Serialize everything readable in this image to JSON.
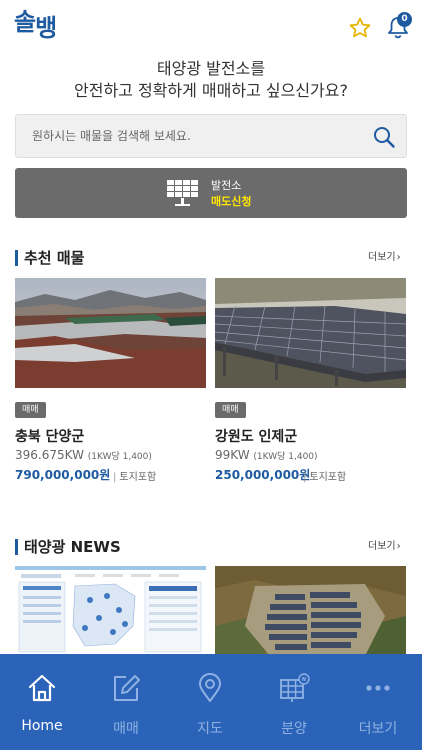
{
  "header": {
    "logo_line1": "솔",
    "logo_line2": "뱅",
    "notification_count": "0"
  },
  "hero": {
    "line1": "태양광 발전소를",
    "line2": "안전하고 정확하게 매매하고 싶으신가요?"
  },
  "search": {
    "placeholder": "원하시는 매물을 검색해 보세요."
  },
  "sell_button": {
    "line1": "발전소",
    "line2": "매도신청"
  },
  "recommended": {
    "title": "추천 매물",
    "more": "더보기",
    "items": [
      {
        "badge": "매매",
        "location": "충북 단양군",
        "capacity": "396.675KW",
        "unit_price": "(1KW당 1,400)",
        "price": "790,000,000원",
        "land": "토지포함"
      },
      {
        "badge": "매매",
        "location": "강원도 인제군",
        "capacity": "99KW",
        "unit_price": "(1KW당 1,400)",
        "price": "250,000,000원",
        "land": "토지포함"
      }
    ]
  },
  "news": {
    "title": "태양광 NEWS",
    "more": "더보기"
  },
  "bottom_nav": {
    "items": [
      {
        "label": "Home",
        "icon": "home-icon"
      },
      {
        "label": "매매",
        "icon": "edit-icon"
      },
      {
        "label": "지도",
        "icon": "map-pin-icon"
      },
      {
        "label": "분양",
        "icon": "solar-panel-new-icon"
      },
      {
        "label": "더보기",
        "icon": "more-dots-icon"
      }
    ],
    "active_index": 0
  },
  "colors": {
    "brand": "#1e5aa0",
    "nav_bg": "#2a63b8",
    "highlight": "#ffe600",
    "button_gray": "#6b6b6b"
  }
}
